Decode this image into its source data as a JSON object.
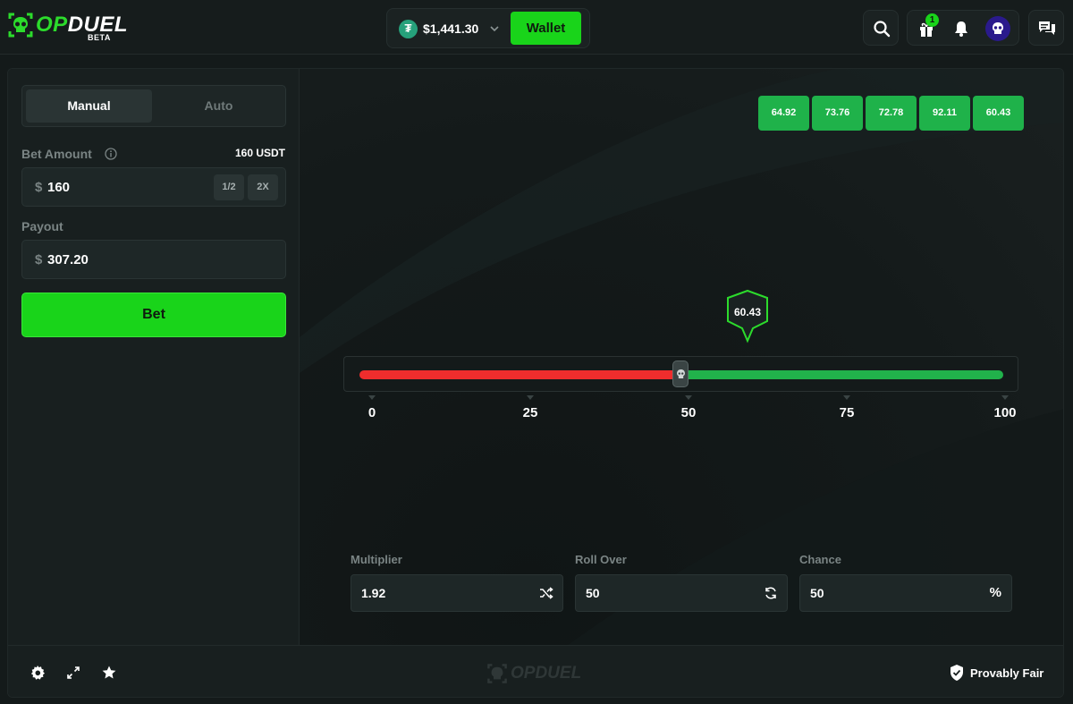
{
  "header": {
    "logo_text_accent": "OP",
    "logo_text_rest": "DUEL",
    "logo_badge": "BETA",
    "balance": "$1,441.30",
    "currency_icon": "tether-icon",
    "wallet_label": "Wallet",
    "gift_count": "1",
    "icons": [
      "search-icon",
      "gift-icon",
      "bell-icon",
      "avatar",
      "chat-icon"
    ]
  },
  "sidebar": {
    "tabs": [
      {
        "label": "Manual",
        "active": true
      },
      {
        "label": "Auto",
        "active": false
      }
    ],
    "bet_amount_label": "Bet Amount",
    "bet_amount_currency_value": "160 USDT",
    "bet_amount_prefix": "$",
    "bet_amount_value": "160",
    "half_label": "1/2",
    "double_label": "2X",
    "payout_label": "Payout",
    "payout_prefix": "$",
    "payout_value": "307.20",
    "bet_button_label": "Bet"
  },
  "game": {
    "history": [
      "64.92",
      "73.76",
      "72.78",
      "92.11",
      "60.43"
    ],
    "result": "60.43",
    "roll_over_threshold": 50,
    "scale_ticks": [
      "0",
      "25",
      "50",
      "75",
      "100"
    ],
    "colors": {
      "lose": "#ef2d2d",
      "win": "#21b24b",
      "accent": "#19d41a"
    },
    "multiplier_label": "Multiplier",
    "multiplier_value": "1.92",
    "roll_over_label": "Roll Over",
    "roll_over_value": "50",
    "chance_label": "Chance",
    "chance_value": "50",
    "chance_unit": "%"
  },
  "footer": {
    "icons": [
      "gear-icon",
      "expand-icon",
      "star-icon"
    ],
    "watermark_text": "OPDUEL",
    "provably_fair_label": "Provably Fair"
  }
}
